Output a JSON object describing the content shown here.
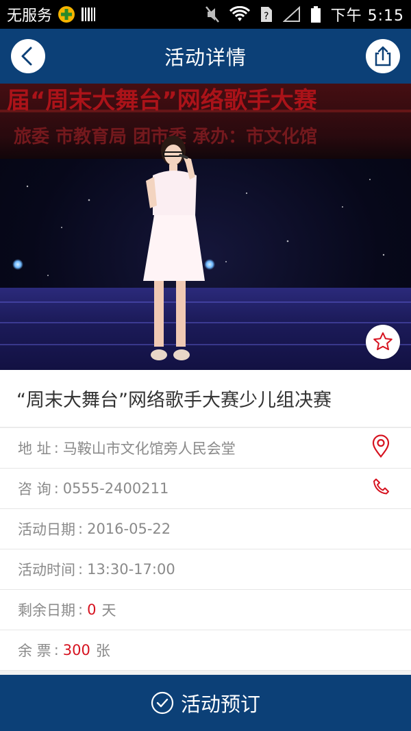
{
  "status_bar": {
    "carrier": "无服务",
    "time": "下午 5:15"
  },
  "nav": {
    "title": "活动详情",
    "back_icon": "back-icon",
    "share_icon": "share-icon"
  },
  "hero": {
    "banner_line1": "届“周末大舞台”网络歌手大赛",
    "banner_line2": "旅委   市教育局   团市委    承办：市文化馆",
    "favorite_icon": "star-icon"
  },
  "event": {
    "title": "“周末大舞台”网络歌手大赛少儿组决赛",
    "address_label": "地       址",
    "address_value": "马鞍山市文化馆旁人民会堂",
    "consult_label": "咨       询",
    "consult_value": "0555-2400211",
    "date_label": "活动日期",
    "date_value": "2016-05-22",
    "time_label": "活动时间",
    "time_value": "13:30-17:00",
    "remaining_days_label": "剩余日期",
    "remaining_days_value": "0",
    "remaining_days_unit": "天",
    "tickets_label": "余       票",
    "tickets_value": "300",
    "tickets_unit": "张",
    "separator": ":"
  },
  "booking": {
    "label": "活动预订",
    "icon": "check-circle-icon"
  },
  "colors": {
    "brand": "#0c4077",
    "accent_red": "#d6121f",
    "text_gray": "#8a8a8a"
  }
}
